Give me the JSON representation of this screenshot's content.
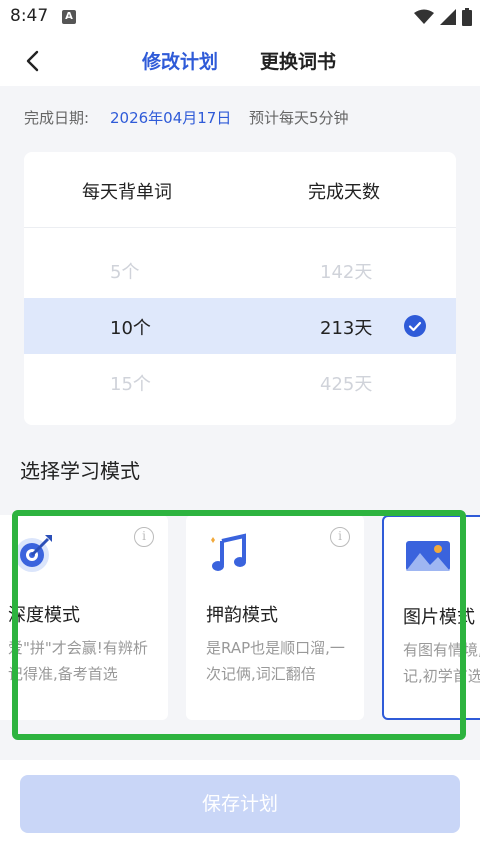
{
  "status_bar": {
    "time": "8:47",
    "notification_letter": "A"
  },
  "nav": {
    "tabs": [
      {
        "label": "修改计划",
        "active": true
      },
      {
        "label": "更换词书",
        "active": false
      }
    ]
  },
  "plan_info": {
    "date_label": "完成日期:",
    "date_value": "2026年04月17日",
    "estimate": "预计每天5分钟"
  },
  "plan_picker": {
    "col_words_header": "每天背单词",
    "col_days_header": "完成天数",
    "rows": [
      {
        "words": "5个",
        "days": "142天",
        "selected": false
      },
      {
        "words": "10个",
        "days": "213天",
        "selected": true
      },
      {
        "words": "15个",
        "days": "425天",
        "selected": false
      }
    ]
  },
  "modes": {
    "title": "选择学习模式",
    "items": [
      {
        "name": "深度模式",
        "desc": "爱\"拼\"才会赢!有辨析记得准,备考首选",
        "icon": "target-icon"
      },
      {
        "name": "押韵模式",
        "desc": "是RAP也是顺口溜,一次记俩,词汇翻倍",
        "icon": "music-note-icon"
      },
      {
        "name": "图片模式",
        "desc": "有图有情境,又好记,初学首选",
        "icon": "landscape-image-icon"
      }
    ]
  },
  "bottom": {
    "save_label": "保存计划"
  },
  "colors": {
    "accent": "#2f5bd8",
    "highlight_frame": "#2db33f",
    "selected_row": "#dfe8fb"
  }
}
